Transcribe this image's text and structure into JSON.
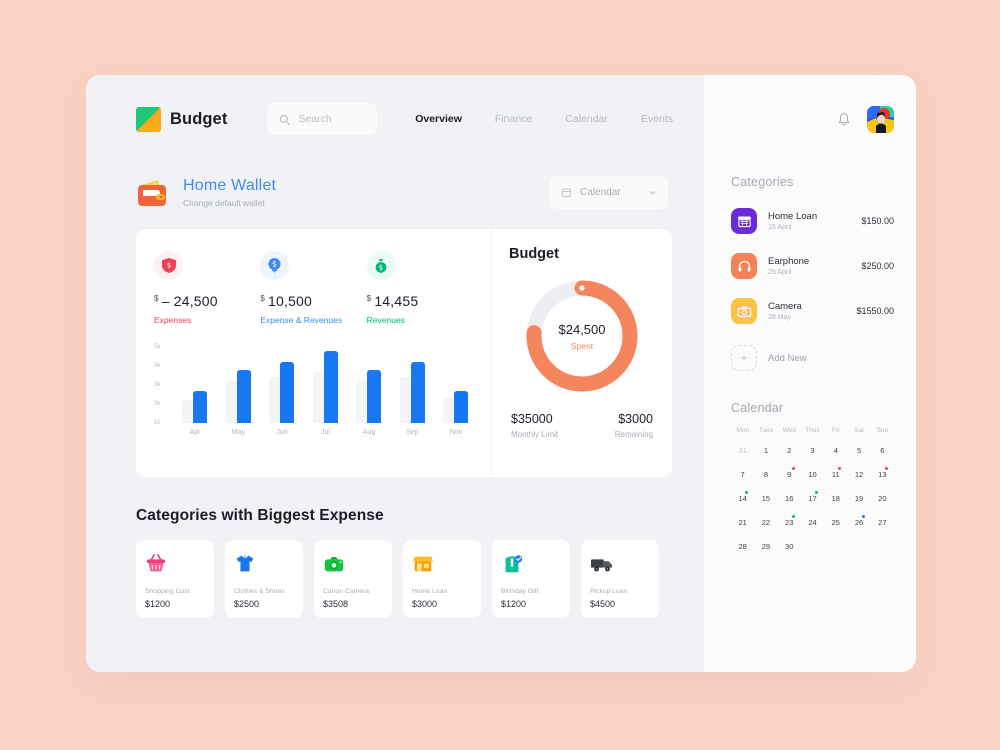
{
  "theme": {
    "page_bg": "#fbd2c4",
    "card_bg": "#f1f2f6",
    "accent_orange": "#f4855c",
    "accent_blue": "#1877f2",
    "link_blue": "#3d8bf5"
  },
  "topbar": {
    "brand": "Budget",
    "logo_icon": "budget-logo-icon",
    "search": {
      "placeholder": "Search",
      "value": "",
      "icon": "search-icon"
    },
    "nav": [
      {
        "label": "Overview",
        "active": true
      },
      {
        "label": "Finance",
        "active": false
      },
      {
        "label": "Calendar",
        "active": false
      },
      {
        "label": "Events",
        "active": false
      }
    ]
  },
  "wallet": {
    "icon": "wallet-icon",
    "title": "Home Wallet",
    "subtitle": "Change default wallet",
    "date_select": {
      "label": "Calendar",
      "icon": "calendar-icon",
      "chevron": "chevron-down-icon"
    }
  },
  "stats": [
    {
      "icon": "shield-dollar-icon",
      "currency": "$",
      "value": "– 24,500",
      "label": "Expenses",
      "color": "#ef4056",
      "icon_bg": "#fdf0f1"
    },
    {
      "icon": "coin-dollar-icon",
      "currency": "$",
      "value": "10,500",
      "label": "Expense & Revenues",
      "color": "#3d8bf5",
      "icon_bg": "#eef4fe"
    },
    {
      "icon": "money-bag-icon",
      "currency": "$",
      "value": "14,455",
      "label": "Revenues",
      "color": "#00b87c",
      "icon_bg": "#eafaf4"
    }
  ],
  "chart_data": {
    "type": "bar",
    "title": "",
    "xlabel": "",
    "ylabel": "",
    "categories": [
      "Apr",
      "May",
      "Jun",
      "Jul",
      "Aug",
      "Sep",
      "Nov"
    ],
    "ytick_labels": [
      "5k",
      "4k",
      "3k",
      "2k",
      "1k"
    ],
    "ytick_values": [
      5000,
      4000,
      3000,
      2000,
      1000
    ],
    "ylim": [
      1000,
      5000
    ],
    "grid": false,
    "legend": "none",
    "series": [
      {
        "name": "Budget",
        "color": "#f3f4f8",
        "values": [
          2200,
          3200,
          3400,
          3700,
          3200,
          3400,
          2300
        ]
      },
      {
        "name": "Actual",
        "color": "#1877f2",
        "values": [
          2700,
          3800,
          4200,
          4800,
          3800,
          4200,
          2700
        ]
      }
    ]
  },
  "budget": {
    "title": "Budget",
    "donut": {
      "type": "donut",
      "spent_value": "$24,500",
      "spent_label": "Spent",
      "percent": 76,
      "arc_color": "#f4855c",
      "track_color": "#eceef3"
    },
    "monthly_limit": {
      "value": "$35000",
      "label": "Monthly Limit"
    },
    "remaining": {
      "value": "$3000",
      "label": "Remaining"
    }
  },
  "biggest_expense": {
    "heading": "Categories with Biggest Expense",
    "cards": [
      {
        "icon": "shopping-basket-icon",
        "name": "Shopping Cost",
        "amount": "$1200"
      },
      {
        "icon": "tshirt-icon",
        "name": "Clothes & Shoes",
        "amount": "$2500"
      },
      {
        "icon": "camera-icon",
        "name": "Canon Camera",
        "amount": "$3508"
      },
      {
        "icon": "store-icon",
        "name": "Home Loan",
        "amount": "$3000"
      },
      {
        "icon": "gift-bag-icon",
        "name": "Birthday Gift",
        "amount": "$1200"
      },
      {
        "icon": "truck-icon",
        "name": "Pickup Loan",
        "amount": "$4500"
      }
    ]
  },
  "sidebar": {
    "bell_icon": "notification-bell-icon",
    "avatar_icon": "user-avatar",
    "categories_heading": "Categories",
    "categories": [
      {
        "icon": "store-icon",
        "icon_bg": "#6c2bd9",
        "name": "Home Loan",
        "date": "15 April",
        "amount": "$150.00"
      },
      {
        "icon": "headphone-icon",
        "icon_bg": "#f58158",
        "name": "Earphone",
        "date": "25 April",
        "amount": "$250.00"
      },
      {
        "icon": "camera-icon",
        "icon_bg": "#fbc53f",
        "name": "Camera",
        "date": "28 May",
        "amount": "$1550.00"
      }
    ],
    "add_new": {
      "label": "Add New",
      "icon": "plus-icon"
    },
    "calendar_heading": "Calendar",
    "calendar": {
      "dow": [
        "Mon",
        "Tues",
        "Wed",
        "Thus",
        "Fri",
        "Sat",
        "Sun"
      ],
      "days": [
        {
          "n": "31",
          "muted": true
        },
        {
          "n": "1"
        },
        {
          "n": "2"
        },
        {
          "n": "3"
        },
        {
          "n": "4"
        },
        {
          "n": "5"
        },
        {
          "n": "6"
        },
        {
          "n": "7"
        },
        {
          "n": "8"
        },
        {
          "n": "9",
          "dot": "#ef4056"
        },
        {
          "n": "10"
        },
        {
          "n": "11",
          "dot": "#ef4056"
        },
        {
          "n": "12"
        },
        {
          "n": "13",
          "dot": "#ef4056"
        },
        {
          "n": "14",
          "dot": "#00b87c"
        },
        {
          "n": "15"
        },
        {
          "n": "16"
        },
        {
          "n": "17",
          "dot": "#00b87c"
        },
        {
          "n": "18"
        },
        {
          "n": "19"
        },
        {
          "n": "20"
        },
        {
          "n": "21"
        },
        {
          "n": "22"
        },
        {
          "n": "23",
          "dot": "#00b87c"
        },
        {
          "n": "24"
        },
        {
          "n": "25"
        },
        {
          "n": "26",
          "dot": "#3d6ef5"
        },
        {
          "n": "27"
        },
        {
          "n": "28"
        },
        {
          "n": "29"
        },
        {
          "n": "30"
        }
      ]
    }
  }
}
